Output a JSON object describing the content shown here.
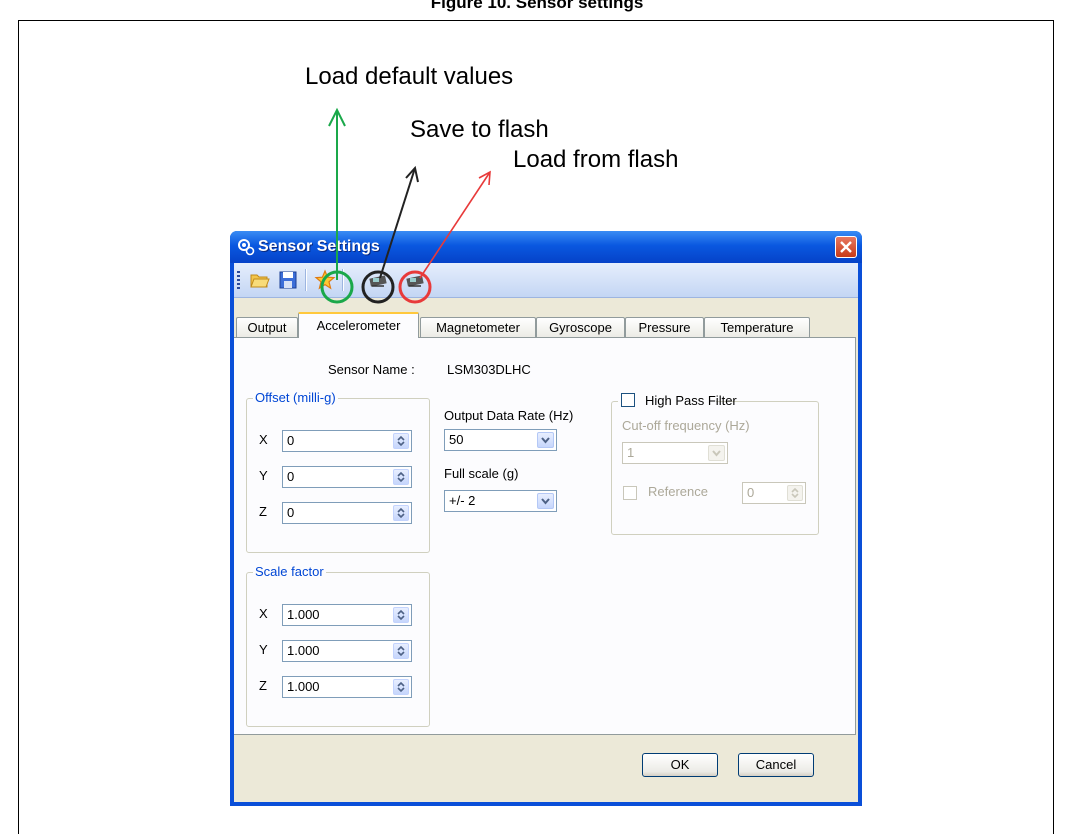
{
  "figure": {
    "caption": "Figure 10. Sensor settings"
  },
  "annotations": {
    "load_default": "Load default values",
    "save_flash": "Save to flash",
    "load_flash": "Load from flash",
    "colors": {
      "load_default": "#1aa84a",
      "save_flash": "#222222",
      "load_flash": "#e83a3a"
    }
  },
  "dialog": {
    "title": "Sensor Settings",
    "toolbar": {
      "items": [
        "open-folder-icon",
        "save-disk-icon",
        "load-default-star-icon",
        "save-to-flash-board-icon",
        "load-from-flash-board-icon"
      ]
    },
    "tabs": [
      "Output",
      "Accelerometer",
      "Magnetometer",
      "Gyroscope",
      "Pressure",
      "Temperature"
    ],
    "active_tab": "Accelerometer",
    "sensor_name_label": "Sensor Name :",
    "sensor_name_value": "LSM303DLHC",
    "offset": {
      "title": "Offset (milli-g)",
      "x_label": "X",
      "x_value": "0",
      "y_label": "Y",
      "y_value": "0",
      "z_label": "Z",
      "z_value": "0"
    },
    "scale": {
      "title": "Scale factor",
      "x_label": "X",
      "x_value": "1.000",
      "y_label": "Y",
      "y_value": "1.000",
      "z_label": "Z",
      "z_value": "1.000"
    },
    "odr": {
      "label": "Output Data Rate (Hz)",
      "value": "50"
    },
    "fullscale": {
      "label": "Full scale (g)",
      "value": "+/- 2"
    },
    "hpf": {
      "label": "High Pass Filter",
      "checked": false,
      "cutoff_label": "Cut-off frequency (Hz)",
      "cutoff_value": "1",
      "reference_label": "Reference",
      "reference_checked": false,
      "reference_value": "0"
    },
    "ok_label": "OK",
    "cancel_label": "Cancel"
  }
}
